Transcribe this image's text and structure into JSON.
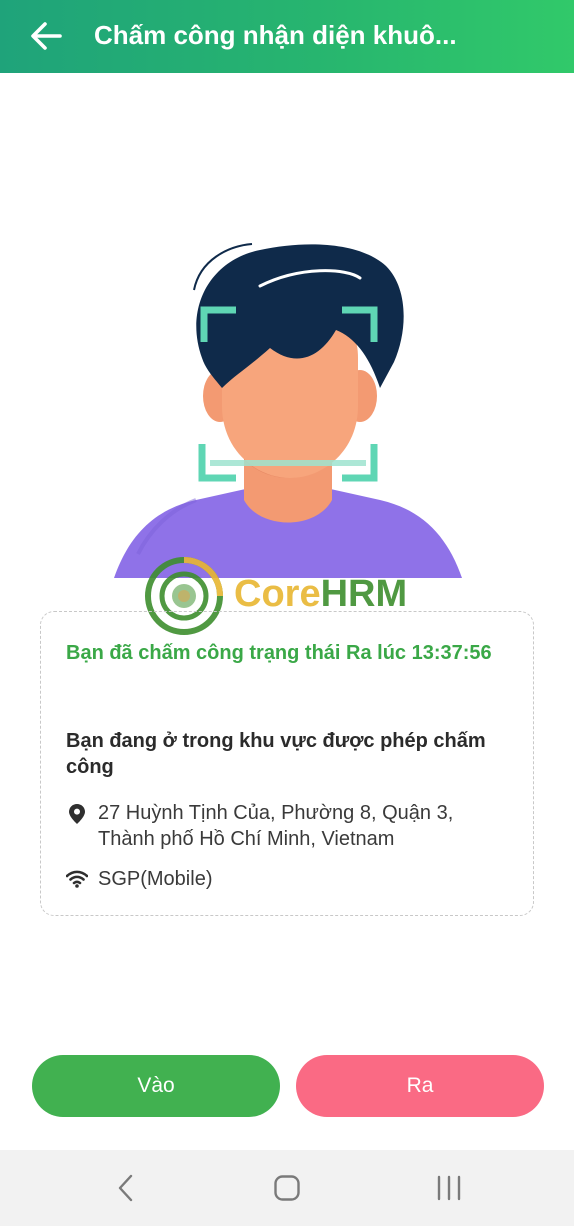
{
  "header": {
    "title": "Chấm công nhận diện khuô...",
    "back_icon": "arrow-left-icon"
  },
  "illustration": {
    "description_icon": "face-scan-illustration"
  },
  "watermark": {
    "core": "Core",
    "hrm": "HRM",
    "logo_icon": "corehrm-logo"
  },
  "card": {
    "status": "Bạn đã chấm công trạng thái Ra lúc 13:37:56",
    "zone": "Bạn đang ở trong khu vực được phép chấm công",
    "address": "27 Huỳnh Tịnh Của, Phường 8, Quận 3, Thành phố Hồ Chí Minh, Vietnam",
    "wifi": "SGP(Mobile)",
    "location_icon": "location-pin-icon",
    "wifi_icon": "wifi-icon"
  },
  "buttons": {
    "check_in": "Vào",
    "check_out": "Ra"
  },
  "navbar": {
    "back_icon": "nav-back-icon",
    "home_icon": "nav-home-icon",
    "recent_icon": "nav-recents-icon"
  },
  "colors": {
    "header_start": "#1fa37a",
    "header_end": "#31c96a",
    "status_green": "#3aa847",
    "check_in_button": "#41b150",
    "check_out_button": "#fa6a84",
    "face_skin": "#f7a57c",
    "hair": "#0f2a4a",
    "shirt": "#8f72e8",
    "scan_frame": "#5fd6b4"
  }
}
